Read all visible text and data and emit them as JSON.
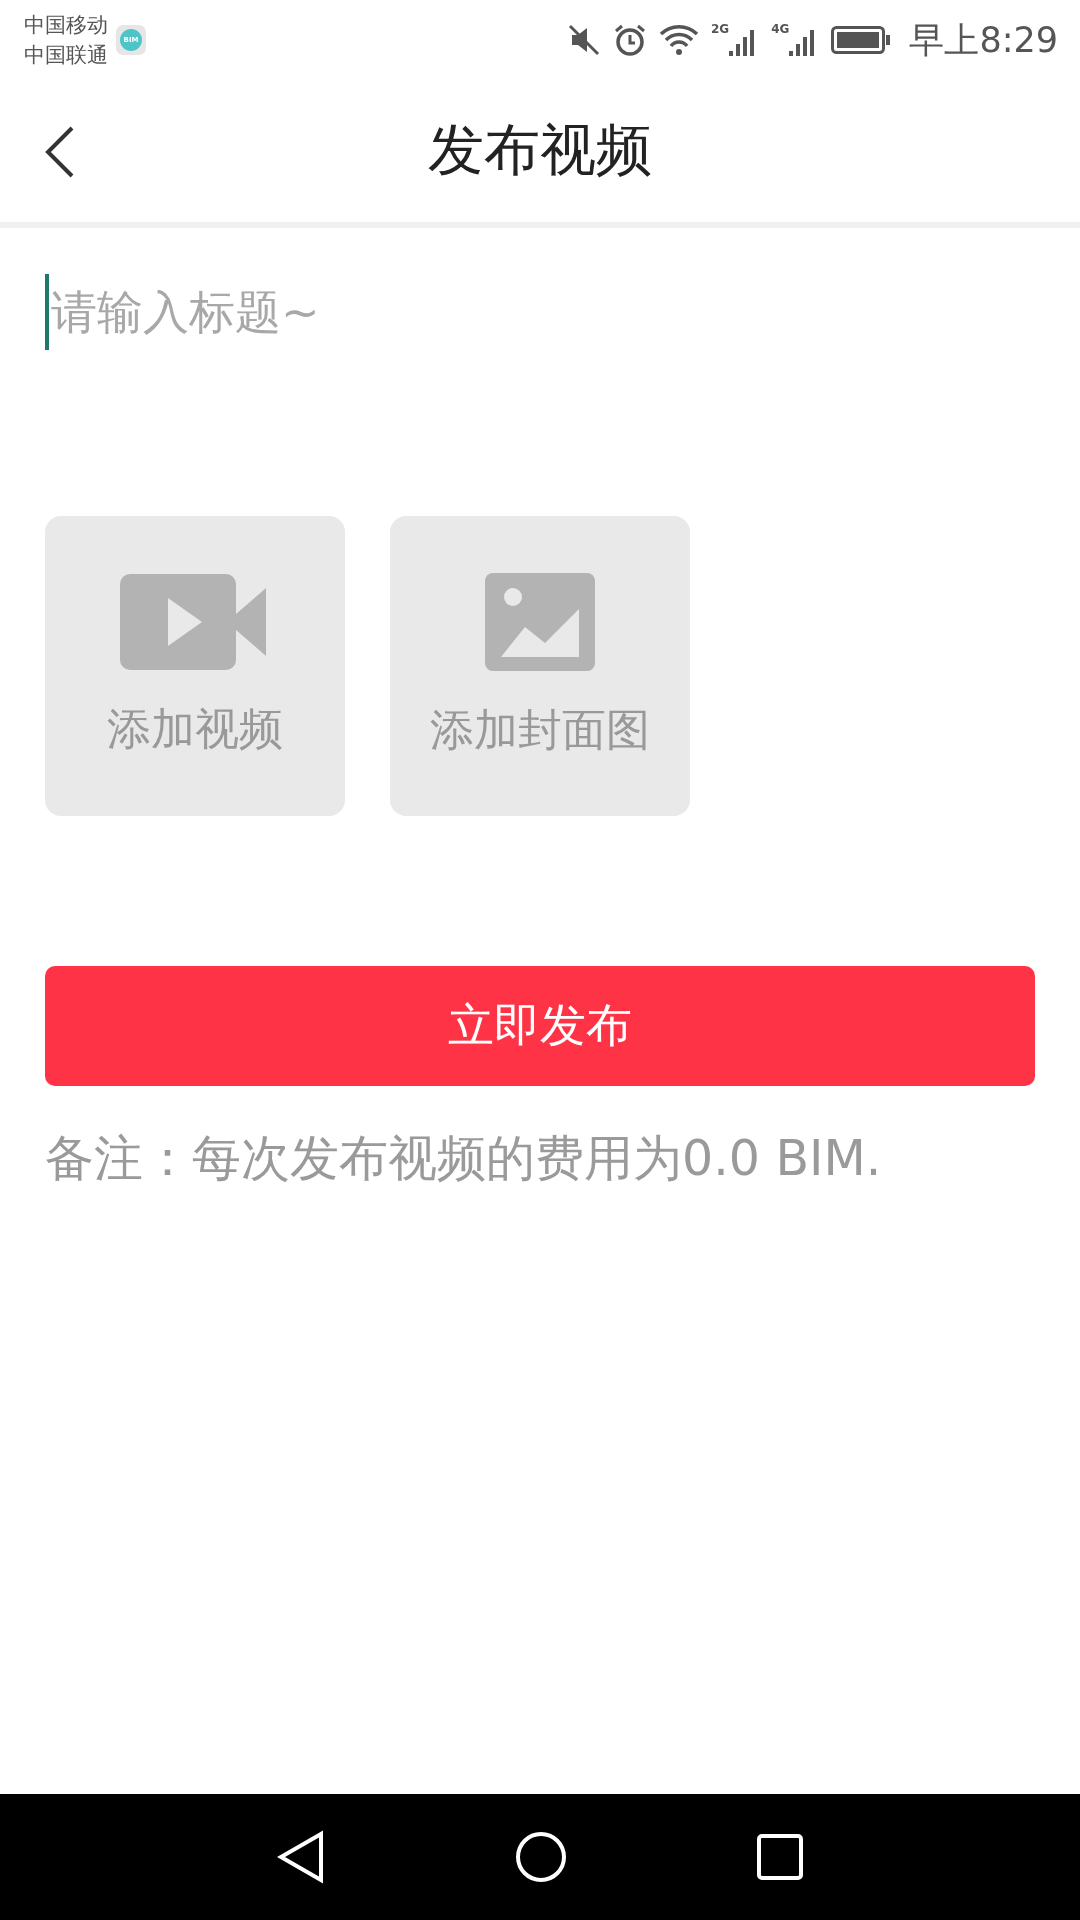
{
  "status_bar": {
    "carriers": [
      "中国移动",
      "中国联通"
    ],
    "app_badge": "BIM",
    "networks": [
      {
        "label": "2G"
      },
      {
        "label": "4G"
      }
    ],
    "time": "早上8:29"
  },
  "header": {
    "title": "发布视频"
  },
  "title_field": {
    "placeholder": "请输入标题~"
  },
  "upload_tiles": [
    {
      "kind": "video",
      "label": "添加视频"
    },
    {
      "kind": "image",
      "label": "添加封面图"
    }
  ],
  "publish_button": "立即发布",
  "note": "备注：每次发布视频的费用为0.0 BIM."
}
